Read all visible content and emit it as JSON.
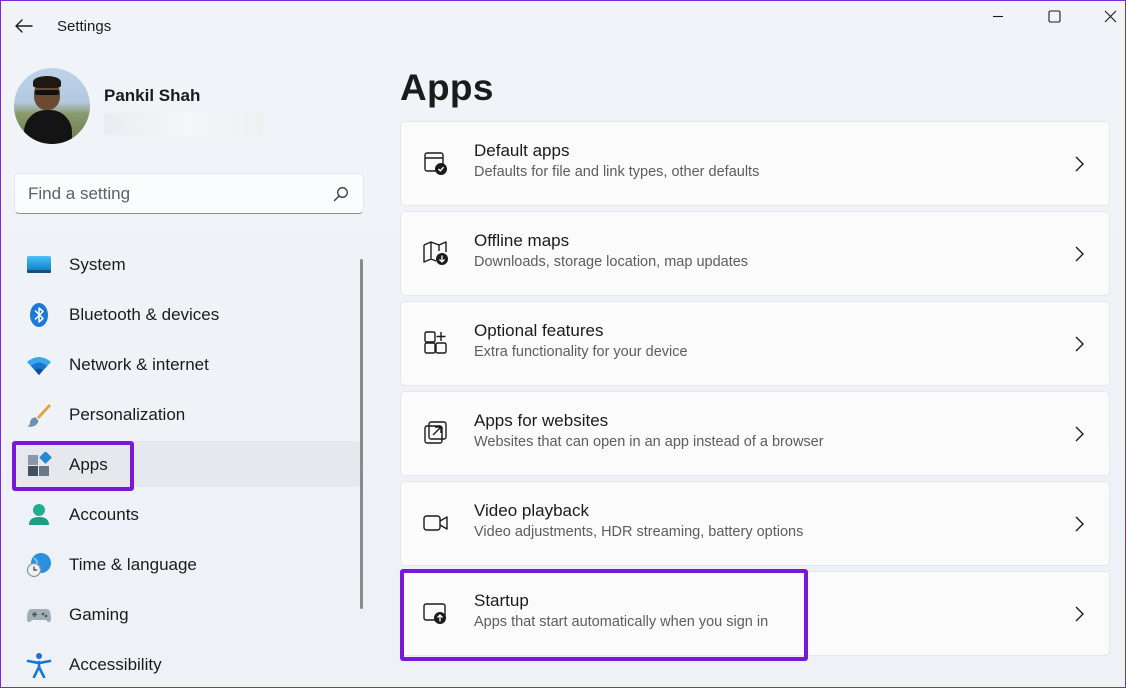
{
  "app": {
    "title": "Settings"
  },
  "profile": {
    "name": "Pankil Shah"
  },
  "search": {
    "placeholder": "Find a setting"
  },
  "nav": {
    "items": [
      {
        "label": "System",
        "icon": "monitor-icon"
      },
      {
        "label": "Bluetooth & devices",
        "icon": "bluetooth-icon"
      },
      {
        "label": "Network & internet",
        "icon": "wifi-icon"
      },
      {
        "label": "Personalization",
        "icon": "brush-icon"
      },
      {
        "label": "Apps",
        "icon": "apps-icon",
        "selected": true
      },
      {
        "label": "Accounts",
        "icon": "person-icon"
      },
      {
        "label": "Time & language",
        "icon": "globe-clock-icon"
      },
      {
        "label": "Gaming",
        "icon": "gamepad-icon"
      },
      {
        "label": "Accessibility",
        "icon": "accessibility-icon"
      }
    ]
  },
  "main": {
    "title": "Apps",
    "cards": [
      {
        "title": "Default apps",
        "subtitle": "Defaults for file and link types, other defaults",
        "icon": "default-apps-icon"
      },
      {
        "title": "Offline maps",
        "subtitle": "Downloads, storage location, map updates",
        "icon": "map-download-icon"
      },
      {
        "title": "Optional features",
        "subtitle": "Extra functionality for your device",
        "icon": "add-feature-icon"
      },
      {
        "title": "Apps for websites",
        "subtitle": "Websites that can open in an app instead of a browser",
        "icon": "open-in-app-icon"
      },
      {
        "title": "Video playback",
        "subtitle": "Video adjustments, HDR streaming, battery options",
        "icon": "video-camera-icon"
      },
      {
        "title": "Startup",
        "subtitle": "Apps that start automatically when you sign in",
        "icon": "startup-icon"
      }
    ]
  },
  "colors": {
    "highlight": "#7a17d9",
    "accent": "#0067c0"
  }
}
